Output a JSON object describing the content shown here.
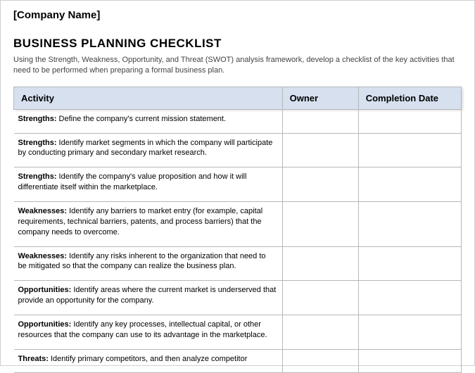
{
  "company_name": "[Company Name]",
  "title": "BUSINESS PLANNING CHECKLIST",
  "intro": "Using the Strength, Weakness, Opportunity, and Threat (SWOT) analysis framework, develop a checklist of the key activities that need to be performed when preparing a formal business plan.",
  "columns": {
    "activity": "Activity",
    "owner": "Owner",
    "completion": "Completion Date"
  },
  "rows": [
    {
      "category": "Strengths:",
      "text": " Define the company's current mission statement.",
      "owner": "",
      "completion": ""
    },
    {
      "category": "Strengths:",
      "text": " Identify market segments in which the company will participate by conducting primary and secondary market research.",
      "owner": "",
      "completion": ""
    },
    {
      "category": "Strengths:",
      "text": " Identify the company's value proposition and how it will differentiate itself within the marketplace.",
      "owner": "",
      "completion": ""
    },
    {
      "category": "Weaknesses:",
      "text": " Identify any barriers to market entry (for example, capital requirements, technical barriers, patents, and process barriers) that the company needs to overcome.",
      "owner": "",
      "completion": ""
    },
    {
      "category": "Weaknesses:",
      "text": " Identify any risks inherent to the organization that need to be mitigated so that the company can realize the business plan.",
      "owner": "",
      "completion": ""
    },
    {
      "category": "Opportunities:",
      "text": " Identify areas where the current market is underserved that provide an opportunity for the company.",
      "owner": "",
      "completion": ""
    },
    {
      "category": "Opportunities:",
      "text": " Identify any key processes, intellectual capital, or other resources that the company can use to its advantage in the marketplace.",
      "owner": "",
      "completion": ""
    },
    {
      "category": "Threats:",
      "text": " Identify primary competitors, and then analyze competitor",
      "owner": "",
      "completion": ""
    }
  ]
}
